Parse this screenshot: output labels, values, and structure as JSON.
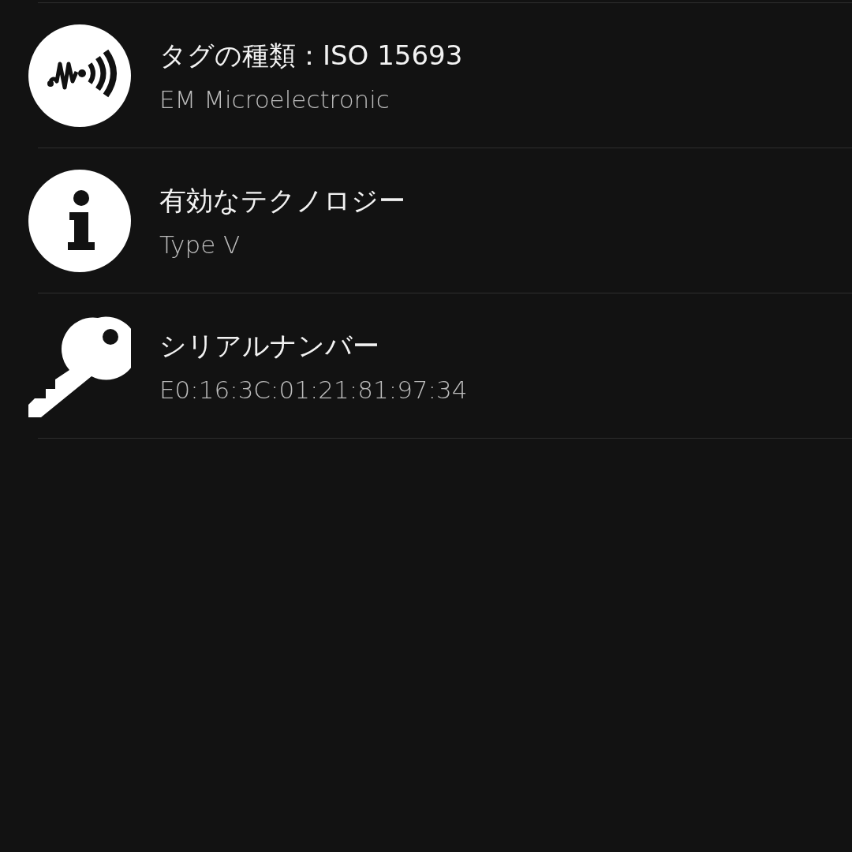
{
  "rows": [
    {
      "kind": "nfc",
      "title": "タグの種類：ISO 15693",
      "subtitle": "EM Microelectronic"
    },
    {
      "kind": "info",
      "title": "有効なテクノロジー",
      "subtitle": "Type V"
    },
    {
      "kind": "key",
      "title": "シリアルナンバー",
      "subtitle": "E0:16:3C:01:21:81:97:34"
    }
  ]
}
